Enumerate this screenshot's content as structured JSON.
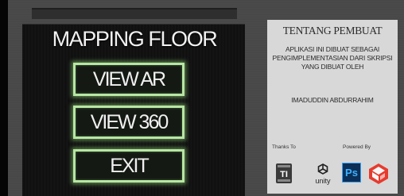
{
  "app": {
    "title": "MAPPING FLOOR"
  },
  "menu": {
    "view_ar_label": "VIEW AR",
    "view_360_label": "VIEW 360",
    "exit_label": "EXIT"
  },
  "about": {
    "title": "TENTANG PEMBUAT",
    "text": "APLIKASI INI DIBUAT SEBAGAI PENGIMPLEMENTASIAN DARI SKRIPSI YANG DIBUAT OLEH",
    "author": "IMADUDDIN ABDURRAHIM",
    "thanks_label": "Thanks To",
    "powered_label": "Powered By",
    "logos": {
      "ti": "TI",
      "unity": "unity",
      "photoshop": "Ps"
    }
  },
  "colors": {
    "button_border": "#b7e6a4",
    "button_glow": "#96dc78",
    "panel_bg": "#d8d8d8",
    "photoshop_blue": "#3fb1ff",
    "sketchup_red": "#e63b2e"
  },
  "icons": [
    "ti-logo-icon",
    "unity-logo-icon",
    "photoshop-logo-icon",
    "sketchup-logo-icon"
  ]
}
